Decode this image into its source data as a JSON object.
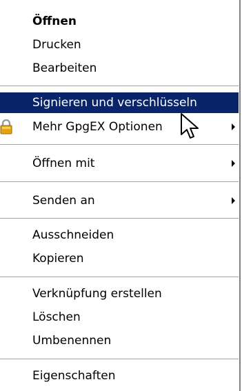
{
  "menu": {
    "open": "Öffnen",
    "print": "Drucken",
    "edit": "Bearbeiten",
    "sign_encrypt": "Signieren und verschlüsseln",
    "more_gpgex": "Mehr GpgEX Optionen",
    "open_with": "Öffnen mit",
    "send_to": "Senden an",
    "cut": "Ausschneiden",
    "copy": "Kopieren",
    "create_shortcut": "Verknüpfung erstellen",
    "delete": "Löschen",
    "rename": "Umbenennen",
    "properties": "Eigenschaften"
  },
  "icons": {
    "gpgex": "lock-icon",
    "submenu": "submenu-arrow-icon",
    "cursor": "mouse-pointer-icon"
  },
  "colors": {
    "highlight_bg": "#0a246a",
    "highlight_text": "#ffffff",
    "lock_body": "#e8a010"
  }
}
